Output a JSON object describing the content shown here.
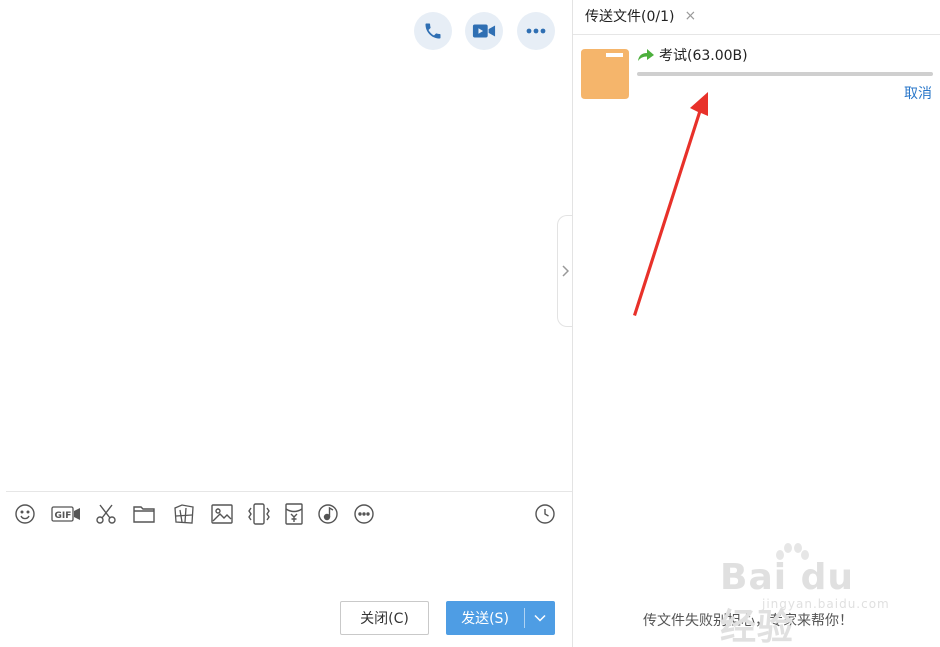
{
  "chat": {
    "top_actions": [
      {
        "name": "phone-call",
        "icon": "phone-icon"
      },
      {
        "name": "video-call",
        "icon": "video-camera-icon"
      },
      {
        "name": "more-actions",
        "icon": "more-dots-icon"
      }
    ],
    "toolbar_icons": [
      "smiley-icon",
      "gif-icon",
      "scissors-icon",
      "folder-icon",
      "image-shake-icon",
      "picture-icon",
      "vibrate-icon",
      "red-packet-icon",
      "music-icon",
      "more-circle-icon",
      "history-clock-icon"
    ],
    "close_button": {
      "label": "关闭(C)"
    },
    "send_button": {
      "label": "发送(S)"
    }
  },
  "side_panel": {
    "tab": {
      "label": "传送文件(0/1)",
      "close_symbol": "×"
    },
    "file": {
      "name": "考试(63.00B)",
      "progress": 0.0,
      "cancel_label": "取消"
    },
    "tip": "传文件失败别担心，专家来帮你！"
  },
  "watermark": {
    "main": "Bai du 经验",
    "sub": "jingyan.baidu.com"
  },
  "colors": {
    "accent": "#4e9de4",
    "icon_blue": "#2f6fb3",
    "link": "#2a77c9",
    "folder": "#f5b56b",
    "annotation": "#e8312a",
    "file_arrow": "#4caf3c"
  }
}
